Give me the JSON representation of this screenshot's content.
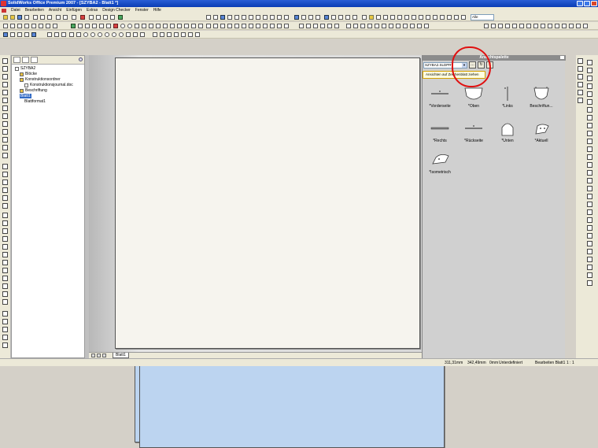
{
  "window": {
    "title": "SolidWorks Office Premium 2007 - [SZYBA2 - Blatt1 *]"
  },
  "menu": [
    "Datei",
    "Bearbeiten",
    "Ansicht",
    "Einfügen",
    "Extras",
    "Design Checker",
    "Fenster",
    "Hilfe"
  ],
  "toolbar": {
    "scale_value": "Alle"
  },
  "tree": {
    "items": [
      {
        "label": "SZYBA2",
        "icon": "drawing-icon"
      },
      {
        "label": "Blöcke",
        "icon": "folder-icon"
      },
      {
        "label": "Konstruktionsordner",
        "icon": "folder-icon"
      },
      {
        "label": "Konstruktionsjournal.doc",
        "icon": "document-icon"
      },
      {
        "label": "Beschriftung",
        "icon": "folder-icon"
      },
      {
        "label": "Blatt1",
        "icon": "sheet-icon"
      },
      {
        "label": "Blattformat1",
        "icon": "sheet-format-icon"
      }
    ]
  },
  "sheet_tabs": {
    "active": "Blatt1"
  },
  "palette": {
    "title": "Ansichtspalette",
    "model_select": "SZYBA2.SLDPRT",
    "tooltip": "Ansichten auf Zeichenblatt ziehen",
    "views": [
      {
        "label": "*Vorderseite"
      },
      {
        "label": "*Oben"
      },
      {
        "label": "*Links"
      },
      {
        "label": "Beschriftun..."
      },
      {
        "label": "*Rechts"
      },
      {
        "label": "*Rückseite"
      },
      {
        "label": "*Unten"
      },
      {
        "label": "*Aktuell"
      },
      {
        "label": "*Isometrisch"
      }
    ]
  },
  "status": {
    "x": "311,31mm",
    "y": "342,49mm",
    "z": "0mm",
    "state": "Unterdefiniert",
    "mode": "Bearbeiten Blatt1",
    "scale": "1 : 1"
  },
  "colors": {
    "title_blue": "#0a3cb4",
    "annotation_red": "#e01010",
    "selection_blue": "#316ac5"
  }
}
